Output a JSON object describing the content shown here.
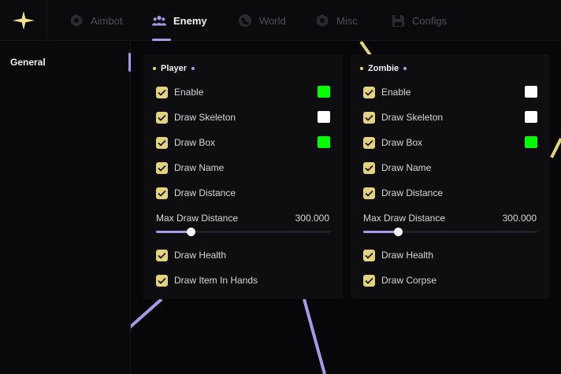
{
  "header": {
    "tabs": [
      {
        "label": "Aimbot",
        "icon": "gear-icon",
        "active": false
      },
      {
        "label": "Enemy",
        "icon": "users-icon",
        "active": true
      },
      {
        "label": "World",
        "icon": "globe-icon",
        "active": false
      },
      {
        "label": "Misc",
        "icon": "cog-icon",
        "active": false
      },
      {
        "label": "Configs",
        "icon": "floppy-disk-icon",
        "active": false
      }
    ]
  },
  "sidebar": {
    "items": [
      {
        "label": "General",
        "active": true
      }
    ]
  },
  "colors": {
    "accent": "#a29be6",
    "checkbox": "#e3d27e",
    "green": "#00ff00",
    "white": "#ffffff"
  },
  "panels": {
    "player": {
      "title": "Player",
      "options": [
        {
          "label": "Enable",
          "checked": true,
          "color": "#00ff00"
        },
        {
          "label": "Draw Skeleton",
          "checked": true,
          "color": "#ffffff"
        },
        {
          "label": "Draw Box",
          "checked": true,
          "color": "#00ff00"
        },
        {
          "label": "Draw Name",
          "checked": true
        },
        {
          "label": "Draw Distance",
          "checked": true
        }
      ],
      "slider": {
        "label": "Max Draw Distance",
        "value": "300.000",
        "fraction": 0.2
      },
      "options_after": [
        {
          "label": "Draw Health",
          "checked": true
        },
        {
          "label": "Draw Item In Hands",
          "checked": true
        }
      ]
    },
    "zombie": {
      "title": "Zombie",
      "options": [
        {
          "label": "Enable",
          "checked": true,
          "color": "#ffffff"
        },
        {
          "label": "Draw Skeleton",
          "checked": true,
          "color": "#ffffff"
        },
        {
          "label": "Draw Box",
          "checked": true,
          "color": "#00ff00"
        },
        {
          "label": "Draw Name",
          "checked": true
        },
        {
          "label": "Draw Distance",
          "checked": true
        }
      ],
      "slider": {
        "label": "Max Draw Distance",
        "value": "300.000",
        "fraction": 0.2
      },
      "options_after": [
        {
          "label": "Draw Health",
          "checked": true
        },
        {
          "label": "Draw Corpse",
          "checked": true
        }
      ]
    }
  }
}
